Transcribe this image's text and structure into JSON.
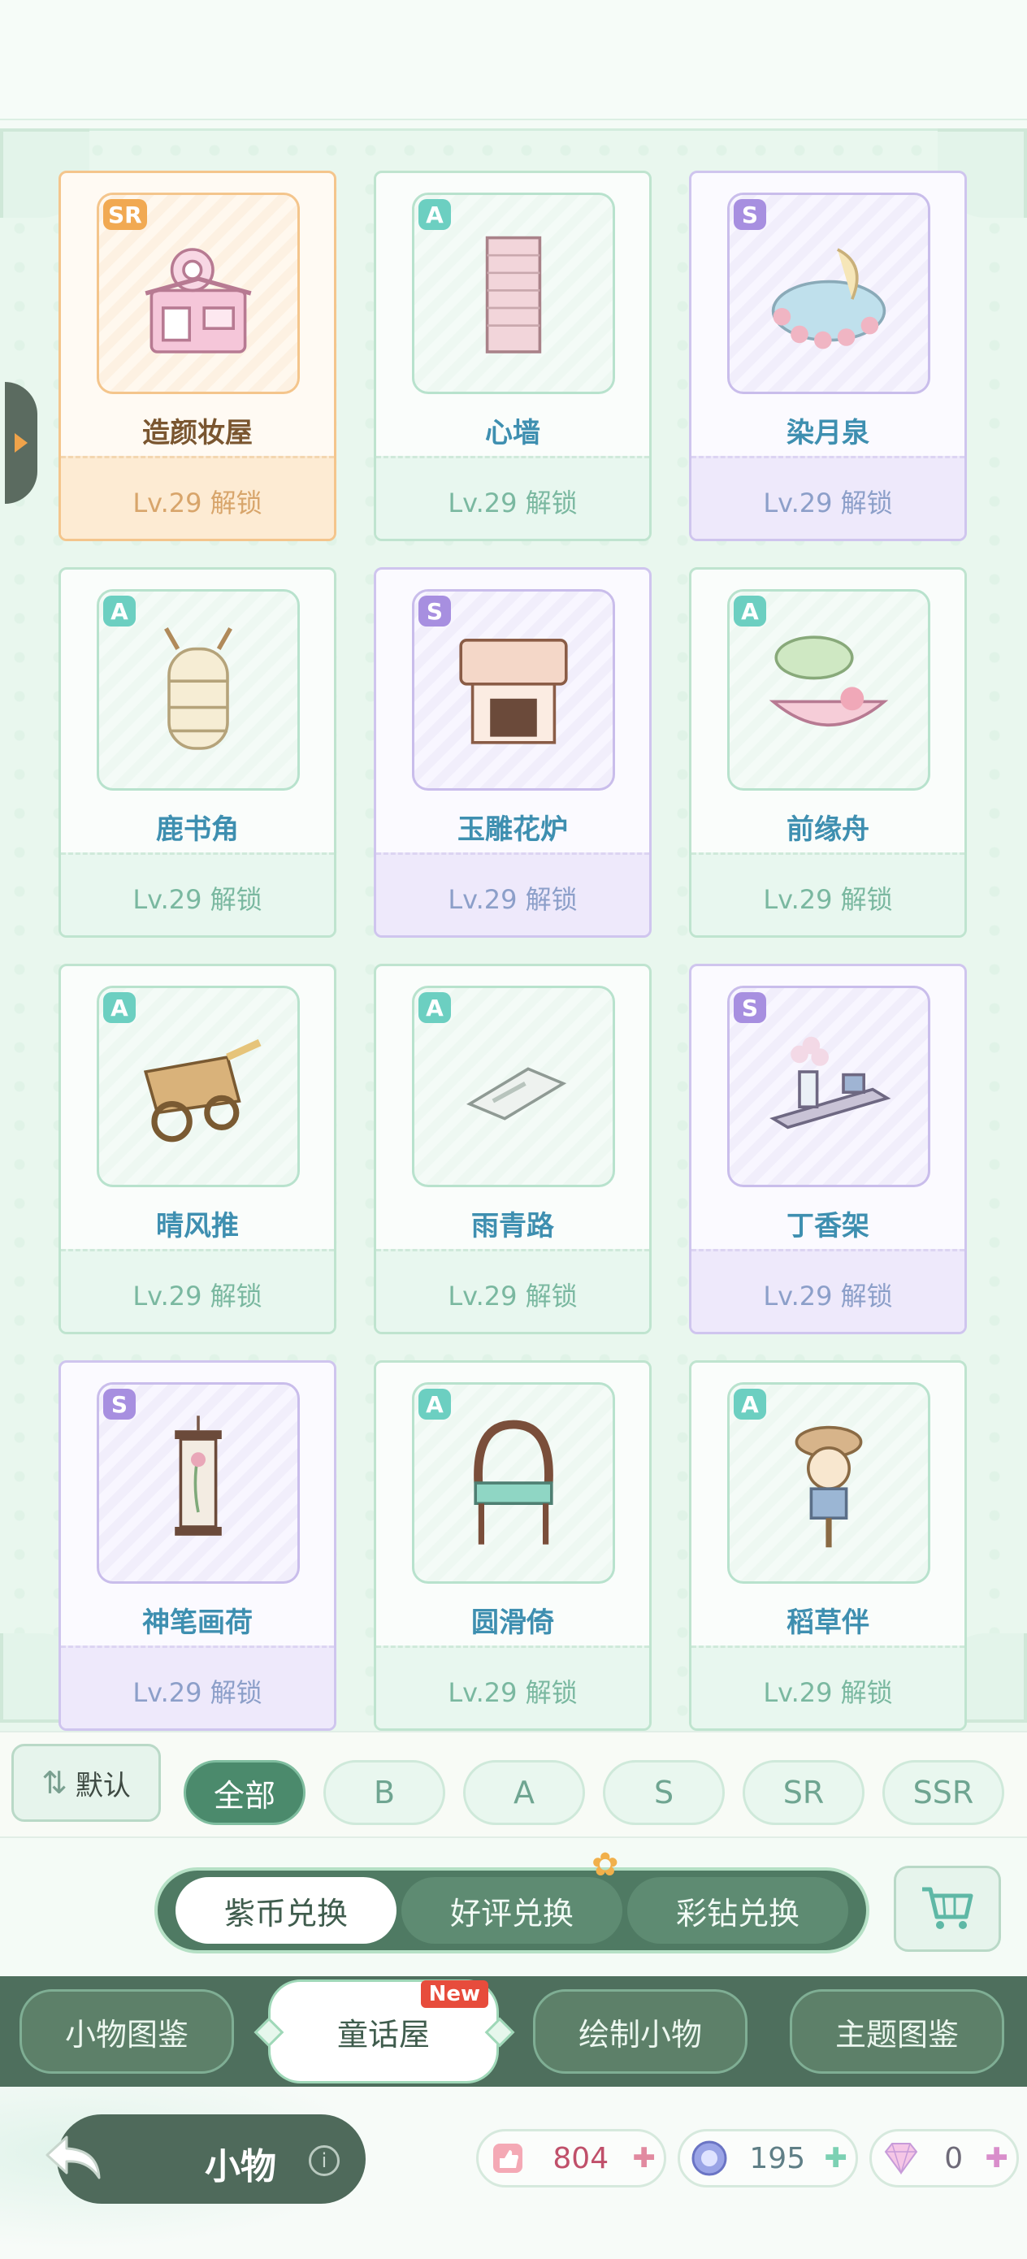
{
  "items": [
    {
      "name": "造颜妆屋",
      "rarity": "SR",
      "unlock": "Lv.29 解锁",
      "icon": "makeup-house-icon"
    },
    {
      "name": "心墙",
      "rarity": "A",
      "unlock": "Lv.29 解锁",
      "icon": "heart-wall-icon"
    },
    {
      "name": "染月泉",
      "rarity": "S",
      "unlock": "Lv.29 解锁",
      "icon": "moon-spring-icon"
    },
    {
      "name": "鹿书角",
      "rarity": "A",
      "unlock": "Lv.29 解锁",
      "icon": "deer-bookshelf-icon"
    },
    {
      "name": "玉雕花炉",
      "rarity": "S",
      "unlock": "Lv.29 解锁",
      "icon": "jade-stove-icon"
    },
    {
      "name": "前缘舟",
      "rarity": "A",
      "unlock": "Lv.29 解锁",
      "icon": "boat-icon"
    },
    {
      "name": "晴风推",
      "rarity": "A",
      "unlock": "Lv.29 解锁",
      "icon": "cart-wagon-icon"
    },
    {
      "name": "雨青路",
      "rarity": "A",
      "unlock": "Lv.29 解锁",
      "icon": "stone-path-icon"
    },
    {
      "name": "丁香架",
      "rarity": "S",
      "unlock": "Lv.29 解锁",
      "icon": "lilac-shelf-icon"
    },
    {
      "name": "神笔画荷",
      "rarity": "S",
      "unlock": "Lv.29 解锁",
      "icon": "lotus-scroll-icon"
    },
    {
      "name": "圆滑倚",
      "rarity": "A",
      "unlock": "Lv.29 解锁",
      "icon": "armchair-icon"
    },
    {
      "name": "稻草伴",
      "rarity": "A",
      "unlock": "Lv.29 解锁",
      "icon": "scarecrow-icon"
    }
  ],
  "sort": {
    "label": "默认"
  },
  "filters": [
    {
      "label": "全部",
      "active": true
    },
    {
      "label": "B",
      "active": false
    },
    {
      "label": "A",
      "active": false
    },
    {
      "label": "S",
      "active": false
    },
    {
      "label": "SR",
      "active": false
    },
    {
      "label": "SSR",
      "active": false
    }
  ],
  "exchange_tabs": [
    {
      "label": "紫币兑换",
      "active": true
    },
    {
      "label": "好评兑换",
      "active": false
    },
    {
      "label": "彩钻兑换",
      "active": false
    }
  ],
  "category_tabs": [
    {
      "label": "小物图鉴",
      "active": false,
      "badge": ""
    },
    {
      "label": "童话屋",
      "active": true,
      "badge": "New"
    },
    {
      "label": "绘制小物",
      "active": false,
      "badge": ""
    },
    {
      "label": "主题图鉴",
      "active": false,
      "badge": ""
    }
  ],
  "page_title": "小物",
  "info_label": "i",
  "currencies": [
    {
      "name": "thumbs-up-coin",
      "value": "804",
      "color": "#c0506a"
    },
    {
      "name": "purple-coin",
      "value": "195",
      "color": "#5f7f86"
    },
    {
      "name": "rainbow-diamond",
      "value": "0",
      "color": "#6e6a78"
    }
  ]
}
